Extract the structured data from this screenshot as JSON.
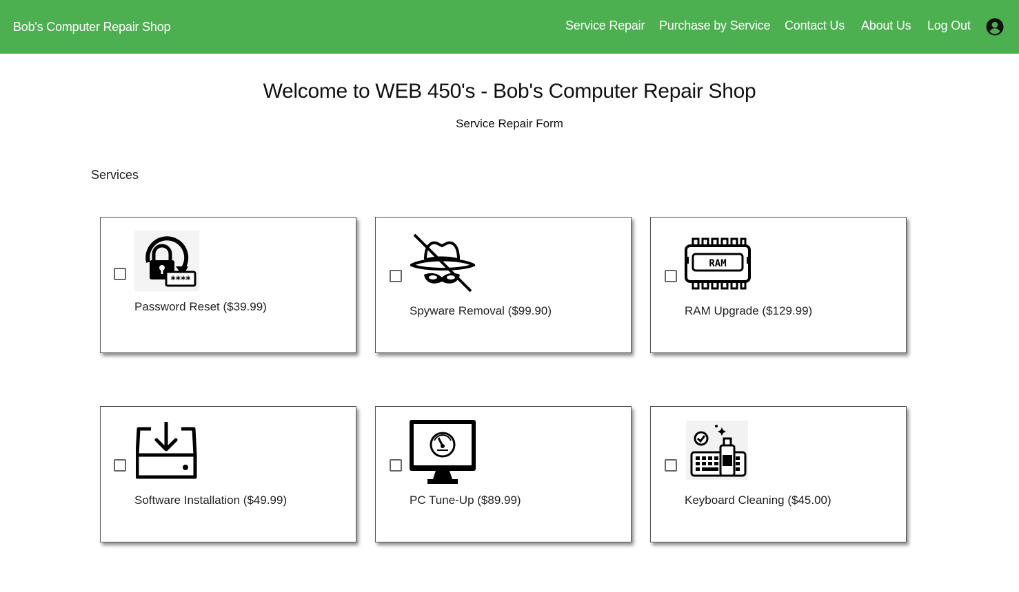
{
  "header": {
    "brand": "Bob's Computer Repair Shop",
    "nav": [
      {
        "label": "Service Repair"
      },
      {
        "label": "Purchase by Service"
      },
      {
        "label": "Contact Us"
      },
      {
        "label": "About Us"
      },
      {
        "label": "Log Out"
      }
    ],
    "account_icon": "account-circle-icon",
    "background_color": "#4caf50"
  },
  "main": {
    "title": "Welcome to WEB 450's - Bob's Computer Repair Shop",
    "subtitle": "Service Repair Form",
    "section_label": "Services",
    "services": [
      {
        "label": "Password Reset ($39.99)",
        "icon": "password-reset-icon",
        "checked": false
      },
      {
        "label": "Spyware Removal ($99.90)",
        "icon": "spyware-removal-icon",
        "checked": false
      },
      {
        "label": "RAM Upgrade ($129.99)",
        "icon": "ram-icon",
        "icon_text": "RAM",
        "checked": false
      },
      {
        "label": "Software Installation ($49.99)",
        "icon": "software-download-icon",
        "checked": false
      },
      {
        "label": "PC Tune-Up ($89.99)",
        "icon": "pc-tune-up-icon",
        "checked": false
      },
      {
        "label": "Keyboard Cleaning ($45.00)",
        "icon": "keyboard-cleaning-icon",
        "checked": false
      }
    ]
  }
}
